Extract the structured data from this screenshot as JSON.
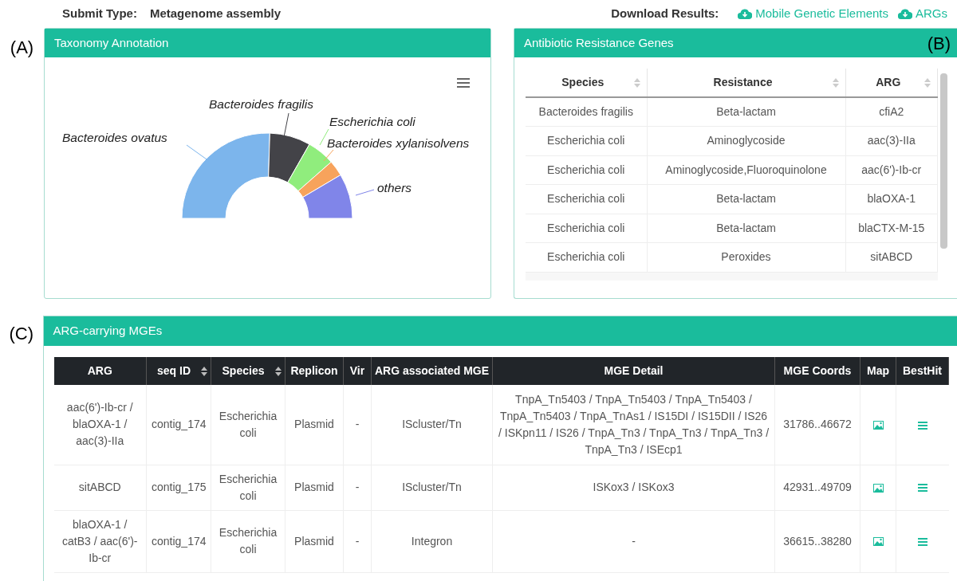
{
  "submit": {
    "label": "Submit Type:",
    "value": "Metagenome assembly"
  },
  "download": {
    "label": "Download Results:",
    "links": [
      "Mobile Genetic Elements",
      "ARGs"
    ]
  },
  "panel_labels": [
    "(A)",
    "(B)",
    "(C)"
  ],
  "taxonomy": {
    "title": "Taxonomy Annotation",
    "slices": [
      {
        "label": "Bacteroides ovatus",
        "color": "#7cb5ec"
      },
      {
        "label": "Bacteroides fragilis",
        "color": "#434348"
      },
      {
        "label": "Escherichia coli",
        "color": "#90ed7d"
      },
      {
        "label": "Bacteroides xylanisolvens",
        "color": "#f7a35c"
      },
      {
        "label": "others",
        "color": "#8085e9"
      }
    ]
  },
  "args": {
    "title": "Antibiotic Resistance Genes",
    "columns": [
      "Species",
      "Resistance",
      "ARG"
    ],
    "rows": [
      [
        "Bacteroides fragilis",
        "Beta-lactam",
        "cfiA2"
      ],
      [
        "Escherichia coli",
        "Aminoglycoside",
        "aac(3)-IIa"
      ],
      [
        "Escherichia coli",
        "Aminoglycoside,Fluoroquinolone",
        "aac(6')-Ib-cr"
      ],
      [
        "Escherichia coli",
        "Beta-lactam",
        "blaOXA-1"
      ],
      [
        "Escherichia coli",
        "Beta-lactam",
        "blaCTX-M-15"
      ],
      [
        "Escherichia coli",
        "Peroxides",
        "sitABCD"
      ]
    ]
  },
  "mges": {
    "title": "ARG-carrying MGEs",
    "columns": [
      {
        "label": "ARG",
        "sortable": false
      },
      {
        "label": "seq ID",
        "sortable": true
      },
      {
        "label": "Species",
        "sortable": true
      },
      {
        "label": "Replicon",
        "sortable": false
      },
      {
        "label": "Vir",
        "sortable": false
      },
      {
        "label": "ARG associated MGE",
        "sortable": false
      },
      {
        "label": "MGE Detail",
        "sortable": false
      },
      {
        "label": "MGE Coords",
        "sortable": false
      },
      {
        "label": "Map",
        "sortable": false
      },
      {
        "label": "BestHit",
        "sortable": false
      }
    ],
    "rows": [
      [
        "aac(6')-Ib-cr / blaOXA-1 / aac(3)-IIa",
        "contig_174",
        "Escherichia coli",
        "Plasmid",
        "-",
        "IScluster/Tn",
        "TnpA_Tn5403 / TnpA_Tn5403 / TnpA_Tn5403 / TnpA_Tn5403 / TnpA_TnAs1 / IS15DI / IS15DII / IS26 / ISKpn11 / IS26 / TnpA_Tn3 / TnpA_Tn3 / TnpA_Tn3 / TnpA_Tn3 / ISEcp1",
        "31786..46672"
      ],
      [
        "sitABCD",
        "contig_175",
        "Escherichia coli",
        "Plasmid",
        "-",
        "IScluster/Tn",
        "ISKox3 / ISKox3",
        "42931..49709"
      ],
      [
        "blaOXA-1 / catB3 / aac(6')-Ib-cr",
        "contig_174",
        "Escherichia coli",
        "Plasmid",
        "-",
        "Integron",
        "-",
        "36615..38280"
      ]
    ]
  }
}
